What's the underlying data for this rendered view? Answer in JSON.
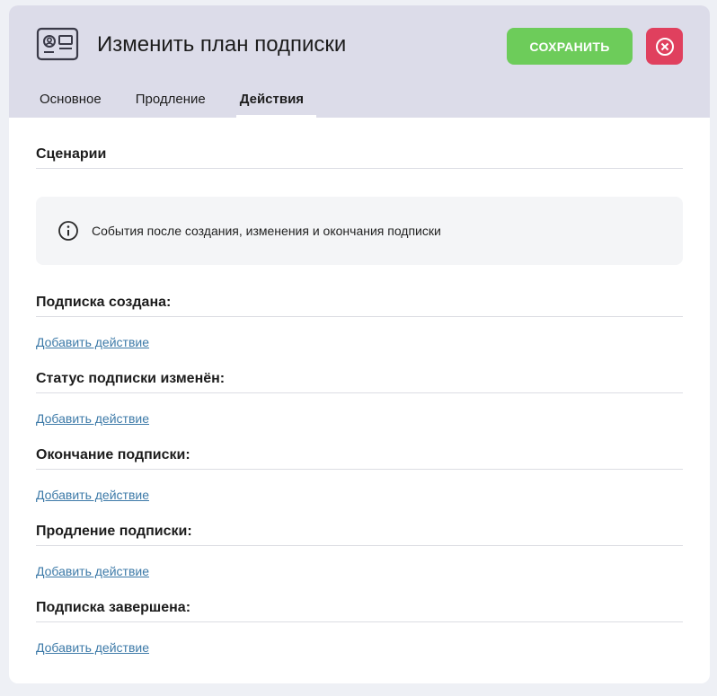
{
  "header": {
    "title": "Изменить план подписки",
    "save_label": "СОХРАНИТЬ"
  },
  "tabs": [
    {
      "label": "Основное",
      "active": false
    },
    {
      "label": "Продление",
      "active": false
    },
    {
      "label": "Действия",
      "active": true
    }
  ],
  "scenarios": {
    "title": "Сценарии",
    "info": "События после создания, изменения и окончания подписки"
  },
  "groups": [
    {
      "title": "Подписка создана:",
      "link": "Добавить действие"
    },
    {
      "title": "Статус подписки изменён:",
      "link": "Добавить действие"
    },
    {
      "title": "Окончание подписки:",
      "link": "Добавить действие"
    },
    {
      "title": "Продление подписки:",
      "link": "Добавить действие"
    },
    {
      "title": "Подписка завершена:",
      "link": "Добавить действие"
    }
  ],
  "colors": {
    "save": "#6dcc5a",
    "close": "#e0405e",
    "link": "#3d7aa8",
    "header_bg": "#dcdce9"
  },
  "icons": {
    "header": "id-card-icon",
    "close": "close-circle-icon",
    "info": "info-icon"
  }
}
